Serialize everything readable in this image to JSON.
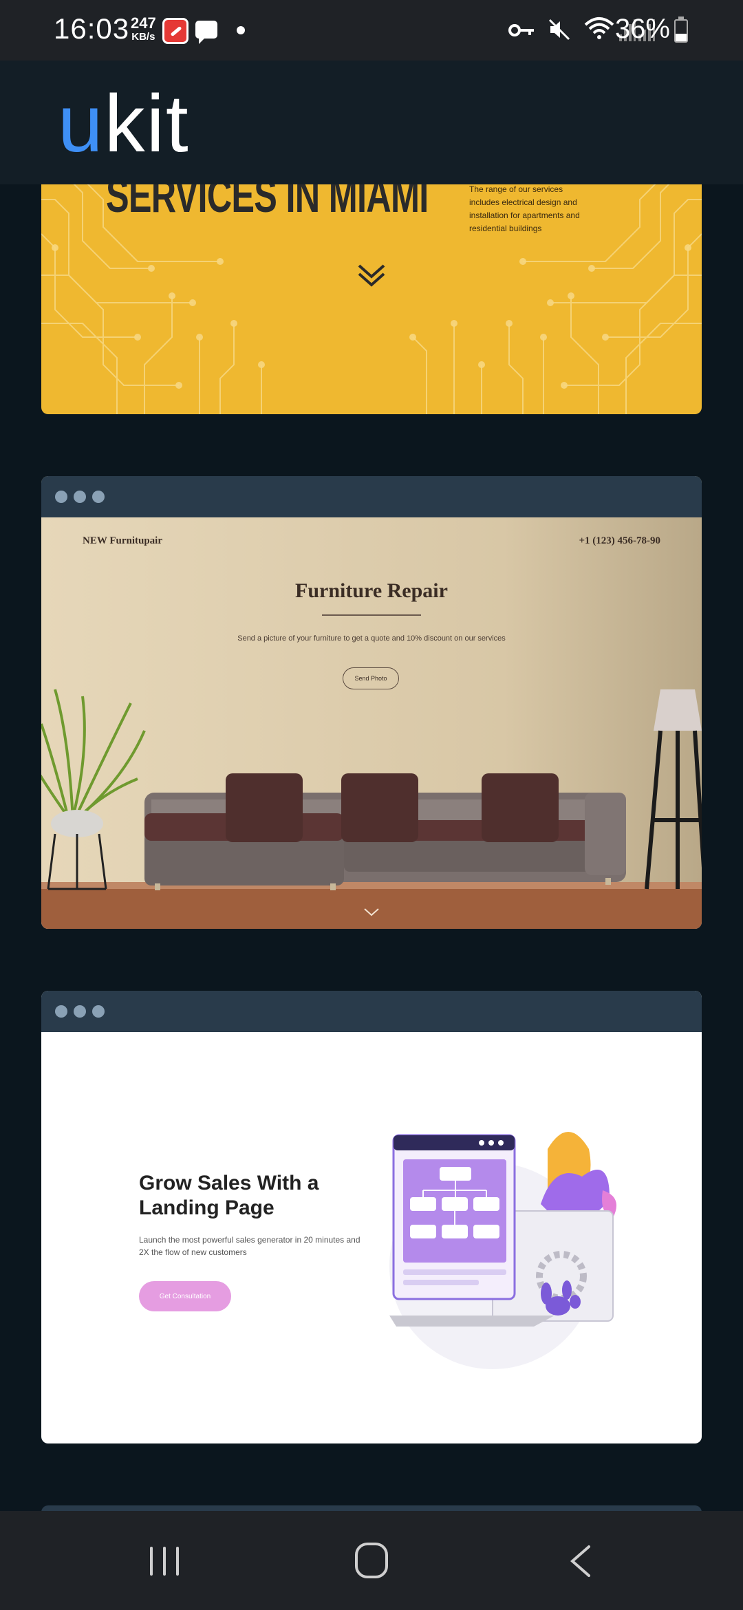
{
  "status_bar": {
    "time": "16:03",
    "speed_value": "247",
    "speed_unit": "KB/s",
    "battery_percent": "36%",
    "icons": [
      "app-icon",
      "message-icon",
      "dot-icon",
      "key-icon",
      "mute-icon",
      "wifi-icon",
      "signal-icon",
      "battery-icon"
    ]
  },
  "header": {
    "logo_first": "u",
    "logo_rest": "kit",
    "logo_accent": "#3e8ff5"
  },
  "templates": [
    {
      "name": "electrical",
      "title": "SERVICES IN MIAMI",
      "description": "The range of our services includes electrical design and installation for apartments and residential buildings",
      "background": "#efb830"
    },
    {
      "name": "furniture",
      "brand": "NEW Furnitupair",
      "phone": "+1 (123) 456-78-90",
      "title": "Furniture Repair",
      "subtitle": "Send a picture of your furniture to get a quote and 10% discount on our services",
      "button": "Send Photo",
      "background": "#e2d4b6"
    },
    {
      "name": "landing",
      "title": "Grow Sales With a Landing Page",
      "subtitle": "Launch the most powerful sales generator in 20 minutes and 2X the flow of new customers",
      "button": "Get Consultation",
      "button_color": "#e59de1"
    }
  ],
  "nav_bar": {
    "icons": [
      "recent-apps-icon",
      "home-icon",
      "back-icon"
    ]
  }
}
